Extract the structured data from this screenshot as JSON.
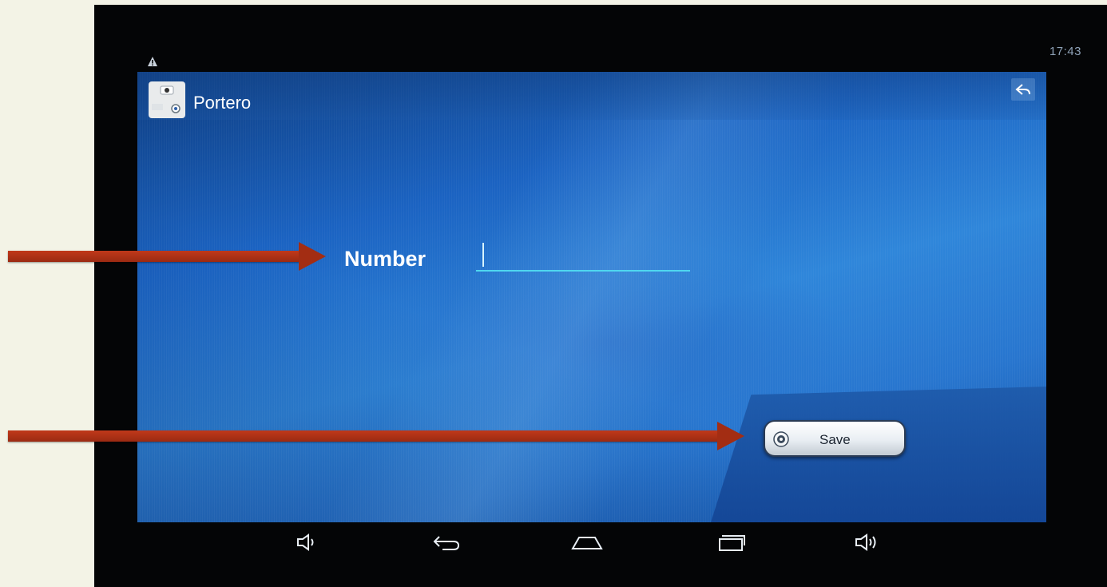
{
  "status_bar": {
    "time": "17:43",
    "left_icon": "warning-icon"
  },
  "action_bar": {
    "app_icon": "intercom-app-icon",
    "title": "Portero",
    "back_icon": "reply-back-icon"
  },
  "form": {
    "number_label": "Number",
    "number_value": "",
    "save_label": "Save",
    "save_icon": "save-target-icon"
  },
  "nav_bar": {
    "items": [
      "volume-down-icon",
      "back-icon",
      "home-icon",
      "recent-apps-icon",
      "volume-up-icon"
    ]
  },
  "annotations": {
    "arrow_color": "#a32d13",
    "accent_color": "#4fd7f0"
  }
}
